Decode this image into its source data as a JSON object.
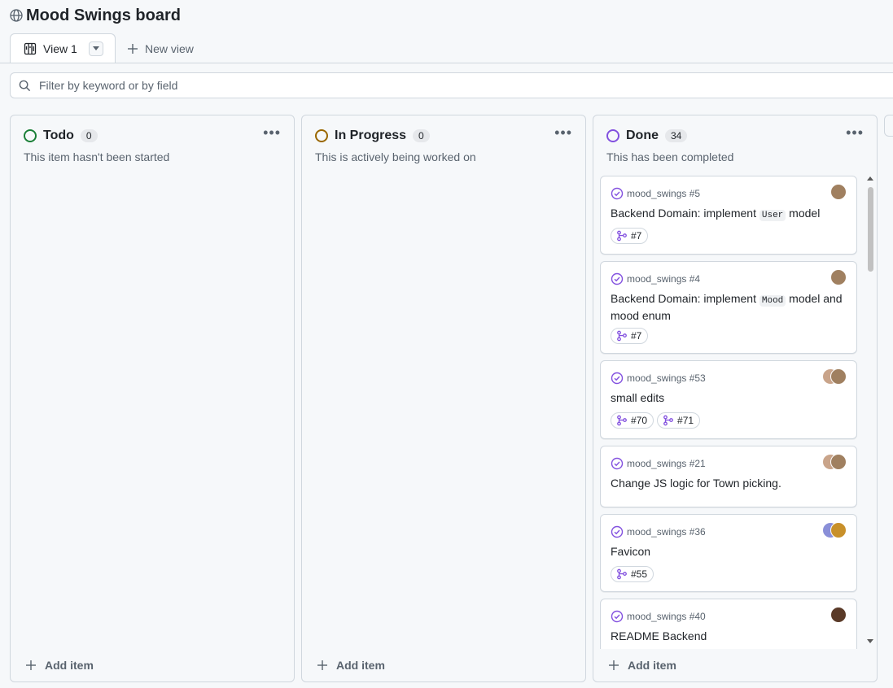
{
  "header": {
    "title": "Mood Swings board"
  },
  "views": {
    "active": "View 1",
    "new_view": "New view"
  },
  "filter": {
    "placeholder": "Filter by keyword or by field"
  },
  "columns": [
    {
      "title": "Todo",
      "count": "0",
      "description": "This item hasn't been started",
      "add_item": "Add item",
      "status_color": "#1a7f37"
    },
    {
      "title": "In Progress",
      "count": "0",
      "description": "This is actively being worked on",
      "add_item": "Add item",
      "status_color": "#9a6700"
    },
    {
      "title": "Done",
      "count": "34",
      "description": "This has been completed",
      "add_item": "Add item",
      "status_color": "#8250df"
    }
  ],
  "cards": [
    {
      "repo": "mood_swings #5",
      "title_before": "Backend Domain: implement ",
      "title_code": "User",
      "title_after": " model",
      "links": [
        "#7"
      ]
    },
    {
      "repo": "mood_swings #4",
      "title_before": "Backend Domain: implement ",
      "title_code": "Mood",
      "title_after": " model and mood enum",
      "links": [
        "#7"
      ]
    },
    {
      "repo": "mood_swings #53",
      "title": "small edits",
      "links": [
        "#70",
        "#71"
      ]
    },
    {
      "repo": "mood_swings #21",
      "title": "Change JS logic for Town picking.",
      "links": []
    },
    {
      "repo": "mood_swings #36",
      "title": "Favicon",
      "links": [
        "#55"
      ]
    },
    {
      "repo": "mood_swings #40",
      "title": "README Backend",
      "links": []
    }
  ],
  "colors": {
    "done_purple": "#8250df",
    "border": "#d0d7de",
    "muted": "#59636e"
  }
}
